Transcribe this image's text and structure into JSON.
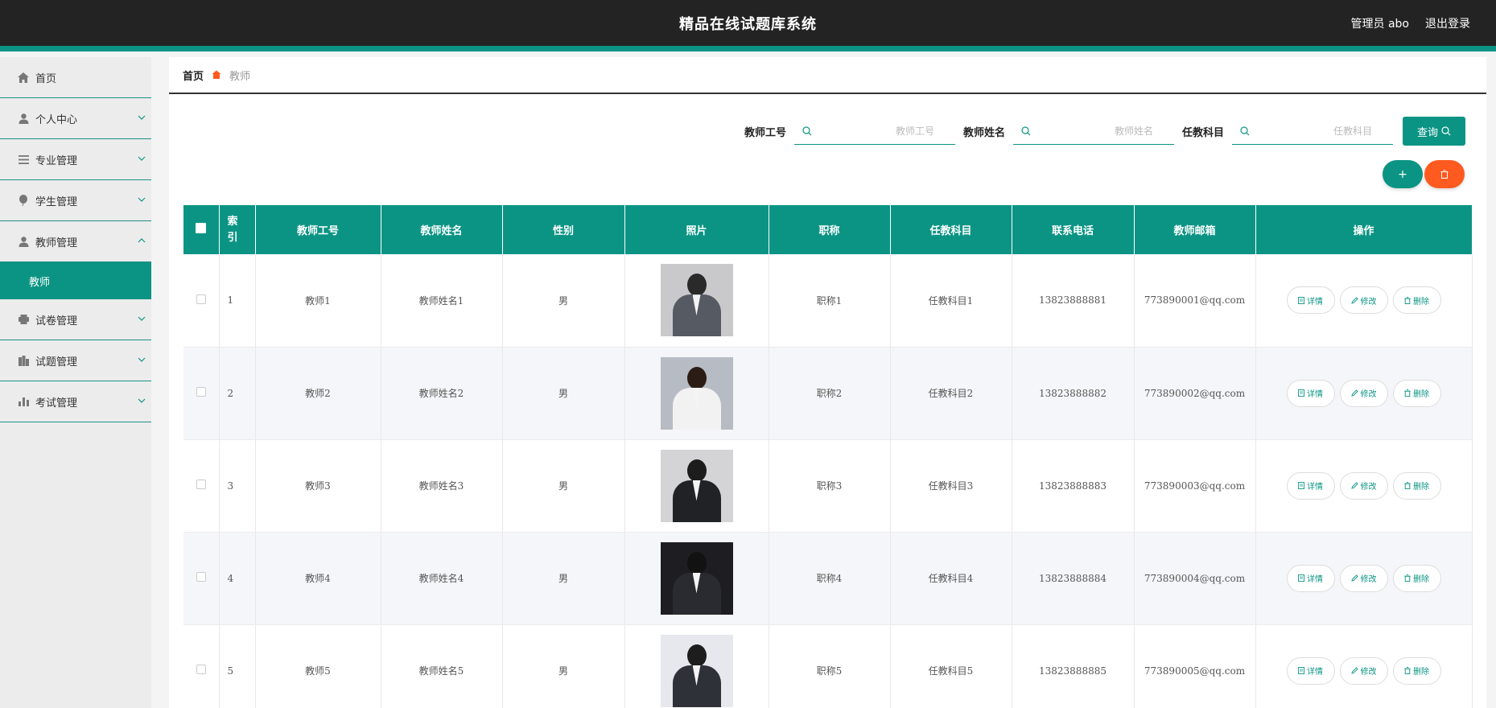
{
  "header": {
    "title": "精品在线试题库系统",
    "user": "管理员 abo",
    "logout": "退出登录"
  },
  "sidebar": {
    "items": [
      {
        "label": "首页",
        "icon": "home-icon"
      },
      {
        "label": "个人中心",
        "icon": "user-icon"
      },
      {
        "label": "专业管理",
        "icon": "list-icon"
      },
      {
        "label": "学生管理",
        "icon": "balloon-icon"
      },
      {
        "label": "教师管理",
        "icon": "user-icon",
        "expanded": true
      },
      {
        "label": "试卷管理",
        "icon": "printer-icon"
      },
      {
        "label": "试题管理",
        "icon": "building-icon"
      },
      {
        "label": "考试管理",
        "icon": "bar-chart-icon"
      }
    ],
    "sub_active": "教师"
  },
  "breadcrumb": {
    "home": "首页",
    "current": "教师"
  },
  "search": {
    "fields": [
      {
        "label": "教师工号",
        "placeholder": "教师工号"
      },
      {
        "label": "教师姓名",
        "placeholder": "教师姓名"
      },
      {
        "label": "任教科目",
        "placeholder": "任教科目"
      }
    ],
    "query_label": "查询"
  },
  "actions": {
    "add_symbol": "+",
    "delete_icon": "trash-icon"
  },
  "table": {
    "columns": [
      "",
      "索引",
      "教师工号",
      "教师姓名",
      "性别",
      "照片",
      "职称",
      "任教科目",
      "联系电话",
      "教师邮箱",
      "操作"
    ],
    "ops": [
      "详情",
      "修改",
      "删除"
    ],
    "rows": [
      {
        "index": "1",
        "id": "教师1",
        "name": "教师姓名1",
        "gender": "男",
        "title": "职称1",
        "subject": "任教科目1",
        "phone": "13823888881",
        "email": "773890001@qq.com"
      },
      {
        "index": "2",
        "id": "教师2",
        "name": "教师姓名2",
        "gender": "男",
        "title": "职称2",
        "subject": "任教科目2",
        "phone": "13823888882",
        "email": "773890002@qq.com"
      },
      {
        "index": "3",
        "id": "教师3",
        "name": "教师姓名3",
        "gender": "男",
        "title": "职称3",
        "subject": "任教科目3",
        "phone": "13823888883",
        "email": "773890003@qq.com"
      },
      {
        "index": "4",
        "id": "教师4",
        "name": "教师姓名4",
        "gender": "男",
        "title": "职称4",
        "subject": "任教科目4",
        "phone": "13823888884",
        "email": "773890004@qq.com"
      },
      {
        "index": "5",
        "id": "教师5",
        "name": "教师姓名5",
        "gender": "男",
        "title": "职称5",
        "subject": "任教科目5",
        "phone": "13823888885",
        "email": "773890005@qq.com"
      }
    ]
  },
  "colors": {
    "accent": "#0b9484",
    "danger": "#ff5a1f",
    "topbar": "#232323",
    "sidebar": "#ececec"
  }
}
